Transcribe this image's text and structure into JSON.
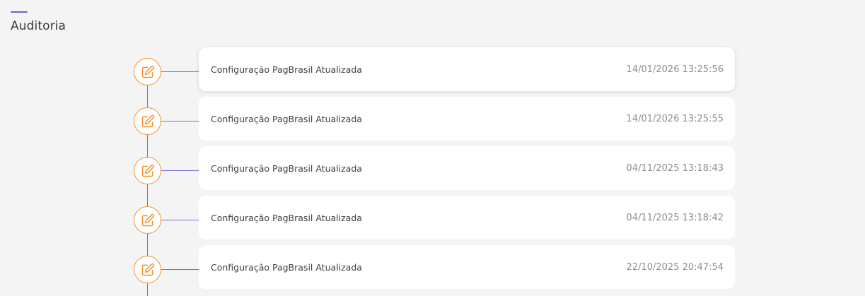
{
  "page": {
    "title": "Auditoria"
  },
  "colors": {
    "accent": "#6f5bd6",
    "timeline_line": "#7a70d8",
    "icon_orange": "#f0922a",
    "card_bg": "#ffffff",
    "page_bg": "#f4f4f4"
  },
  "audit": {
    "entries": [
      {
        "title": "Configuração PagBrasil Atualizada",
        "datetime": "14/01/2026 13:25:56",
        "icon": "edit-icon"
      },
      {
        "title": "Configuração PagBrasil Atualizada",
        "datetime": "14/01/2026 13:25:55",
        "icon": "edit-icon"
      },
      {
        "title": "Configuração PagBrasil Atualizada",
        "datetime": "04/11/2025 13:18:43",
        "icon": "edit-icon"
      },
      {
        "title": "Configuração PagBrasil Atualizada",
        "datetime": "04/11/2025 13:18:42",
        "icon": "edit-icon"
      },
      {
        "title": "Configuração PagBrasil Atualizada",
        "datetime": "22/10/2025 20:47:54",
        "icon": "edit-icon"
      }
    ]
  }
}
